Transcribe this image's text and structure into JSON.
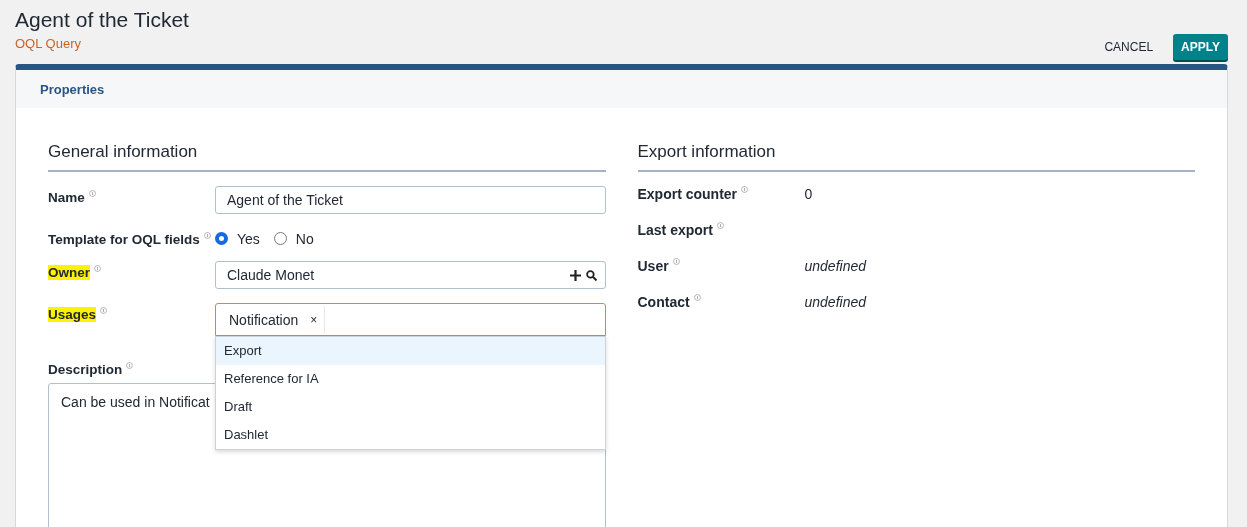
{
  "header": {
    "title": "Agent of the Ticket",
    "subtitle": "OQL Query"
  },
  "buttons": [
    {
      "label": "CANCEL",
      "kind": "flat"
    },
    {
      "label": "APPLY",
      "kind": "primary"
    }
  ],
  "panel": {
    "tab": "Properties"
  },
  "general": {
    "heading": "General information",
    "fields": [
      {
        "kind": "text",
        "label": "Name",
        "highlighted": false,
        "value": "Agent of the Ticket"
      },
      {
        "kind": "radio",
        "label": "Template for OQL fields",
        "highlighted": false,
        "options": [
          {
            "label": "Yes",
            "selected": true
          },
          {
            "label": "No",
            "selected": false
          }
        ]
      },
      {
        "kind": "lookup",
        "label": "Owner",
        "highlighted": true,
        "value": "Claude Monet"
      },
      {
        "kind": "tags",
        "label": "Usages",
        "highlighted": true,
        "tags": [
          "Notification"
        ],
        "tag_remove": "×",
        "menu": [
          {
            "label": "Export",
            "selected": true
          },
          {
            "label": "Reference for IA",
            "selected": false
          },
          {
            "label": "Draft",
            "selected": false
          },
          {
            "label": "Dashlet",
            "selected": false
          }
        ]
      },
      {
        "kind": "textarea",
        "label": "Description",
        "highlighted": false,
        "value": "Can be used in Notificat"
      }
    ]
  },
  "export": {
    "heading": "Export information",
    "fields": [
      {
        "label": "Export counter",
        "value": "0",
        "italic": false
      },
      {
        "label": "Last export"
      },
      {
        "label": "User",
        "value": "undefined",
        "italic": true
      },
      {
        "label": "Contact",
        "value": "undefined",
        "italic": true
      }
    ]
  }
}
